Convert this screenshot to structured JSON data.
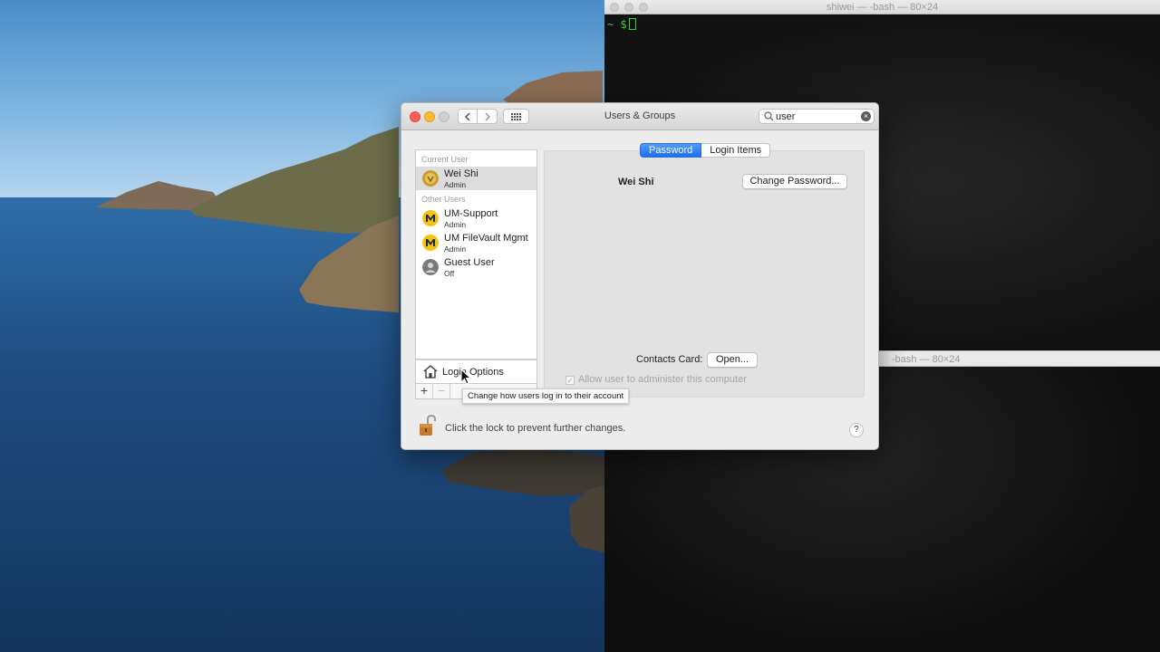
{
  "terminal": {
    "title": "shiwei — -bash — 80×24",
    "prompt": "~ $",
    "second_title": "-bash — 80×24"
  },
  "window": {
    "title": "Users & Groups",
    "search": {
      "value": "user"
    },
    "tabs": [
      {
        "label": "Password",
        "active": true
      },
      {
        "label": "Login Items",
        "active": false
      }
    ],
    "selected_user_name": "Wei Shi",
    "change_password_label": "Change Password...",
    "contacts_label": "Contacts Card:",
    "open_label": "Open...",
    "admin_checkbox_label": "Allow user to administer this computer",
    "lock_text": "Click the lock to prevent further changes.",
    "help_label": "?"
  },
  "user_list": {
    "current_header": "Current User",
    "other_header": "Other Users",
    "current": {
      "name": "Wei Shi",
      "role": "Admin"
    },
    "others": [
      {
        "name": "UM-Support",
        "role": "Admin"
      },
      {
        "name": "UM FileVault Mgmt",
        "role": "Admin"
      },
      {
        "name": "Guest User",
        "role": "Off"
      }
    ],
    "login_options_label": "Login Options",
    "add_label": "+",
    "remove_label": "−",
    "tooltip": "Change how users log in to their account"
  },
  "colors": {
    "accent": "#1f6ff1",
    "terminal_prompt": "#38d13b",
    "close": "#fe5f57",
    "minimize": "#febc2e"
  }
}
